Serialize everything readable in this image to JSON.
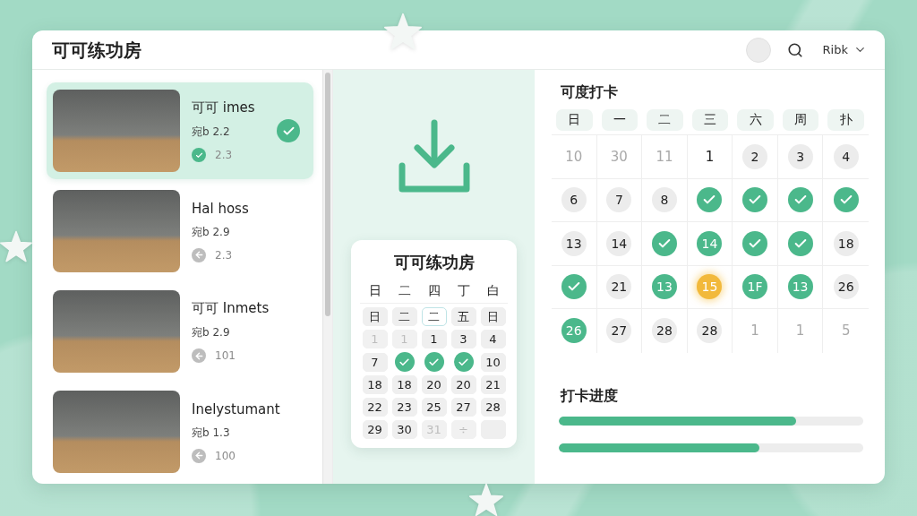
{
  "window": {
    "title": "可可练功房"
  },
  "header": {
    "user_menu": "Ribk"
  },
  "workouts": [
    {
      "title": "可可 imes",
      "meta": "宛b 2.2",
      "count": "2.3",
      "selected": true,
      "done": true
    },
    {
      "title": "Hal hoss",
      "meta": "宛b 2.9",
      "count": "2.3",
      "selected": false,
      "done": false
    },
    {
      "title": "可可 Inmets",
      "meta": "宛b 2.9",
      "count": "101",
      "selected": false,
      "done": false
    },
    {
      "title": "Inelystumant",
      "meta": "宛b 1.3",
      "count": "100",
      "selected": false,
      "done": false
    }
  ],
  "checkin_card": {
    "title": "可可练功房",
    "weekdays": [
      "日",
      "二",
      "四",
      "丁",
      "白"
    ],
    "rows": [
      [
        {
          "label": "日",
          "kind": "chip"
        },
        {
          "label": "二",
          "kind": "chip"
        },
        {
          "label": "二",
          "kind": "outlined"
        },
        {
          "label": "五",
          "kind": "chip"
        },
        {
          "label": "日",
          "kind": "chip"
        }
      ],
      [
        {
          "label": "1",
          "kind": "muted"
        },
        {
          "label": "1",
          "kind": "muted"
        },
        {
          "label": "1",
          "kind": "chip"
        },
        {
          "label": "3",
          "kind": "chip"
        },
        {
          "label": "4",
          "kind": "chip"
        }
      ],
      [
        {
          "label": "7",
          "kind": "chip"
        },
        {
          "kind": "checked"
        },
        {
          "kind": "checked"
        },
        {
          "kind": "checked"
        },
        {
          "label": "10",
          "kind": "chip"
        }
      ],
      [
        {
          "label": "18",
          "kind": "chip"
        },
        {
          "label": "18",
          "kind": "chip"
        },
        {
          "label": "20",
          "kind": "chip"
        },
        {
          "label": "20",
          "kind": "chip"
        },
        {
          "label": "21",
          "kind": "chip"
        }
      ],
      [
        {
          "label": "22",
          "kind": "chip"
        },
        {
          "label": "23",
          "kind": "chip"
        },
        {
          "label": "25",
          "kind": "chip"
        },
        {
          "label": "27",
          "kind": "chip"
        },
        {
          "label": "28",
          "kind": "chip"
        }
      ],
      [
        {
          "label": "29",
          "kind": "chip"
        },
        {
          "label": "30",
          "kind": "chip"
        },
        {
          "label": "31",
          "kind": "muted"
        },
        {
          "label": "÷",
          "kind": "muted"
        },
        {
          "kind": "empty"
        }
      ]
    ]
  },
  "calendar": {
    "title": "可度打卡",
    "weekdays": [
      "日",
      "一",
      "二",
      "三",
      "六",
      "周",
      "扑"
    ],
    "weeks": [
      [
        {
          "label": "10",
          "kind": "outside"
        },
        {
          "label": "30",
          "kind": "outside"
        },
        {
          "label": "11",
          "kind": "outside"
        },
        {
          "label": "1",
          "kind": "plain"
        },
        {
          "label": "2",
          "kind": "pending"
        },
        {
          "label": "3",
          "kind": "pending"
        },
        {
          "label": "4",
          "kind": "pending"
        }
      ],
      [
        {
          "label": "6",
          "kind": "pending"
        },
        {
          "label": "7",
          "kind": "pending"
        },
        {
          "label": "8",
          "kind": "pending"
        },
        {
          "kind": "checked"
        },
        {
          "kind": "checked"
        },
        {
          "kind": "checked"
        },
        {
          "kind": "checked"
        }
      ],
      [
        {
          "label": "13",
          "kind": "pending"
        },
        {
          "label": "14",
          "kind": "pending"
        },
        {
          "kind": "checked"
        },
        {
          "label": "14",
          "kind": "done"
        },
        {
          "kind": "checked"
        },
        {
          "kind": "checked"
        },
        {
          "label": "18",
          "kind": "pending"
        }
      ],
      [
        {
          "kind": "checked"
        },
        {
          "label": "21",
          "kind": "pending"
        },
        {
          "label": "13",
          "kind": "done"
        },
        {
          "label": "15",
          "kind": "today"
        },
        {
          "label": "1F",
          "kind": "done"
        },
        {
          "label": "13",
          "kind": "done"
        },
        {
          "label": "26",
          "kind": "pending"
        }
      ],
      [
        {
          "label": "26",
          "kind": "done"
        },
        {
          "label": "27",
          "kind": "pending"
        },
        {
          "label": "28",
          "kind": "pending"
        },
        {
          "label": "28",
          "kind": "pending"
        },
        {
          "label": "1",
          "kind": "outside"
        },
        {
          "label": "1",
          "kind": "outside"
        },
        {
          "label": "5",
          "kind": "outside"
        }
      ]
    ]
  },
  "progress": {
    "title": "打卡进度",
    "bars": [
      {
        "level": 0.78
      },
      {
        "level": 0.66
      }
    ]
  }
}
